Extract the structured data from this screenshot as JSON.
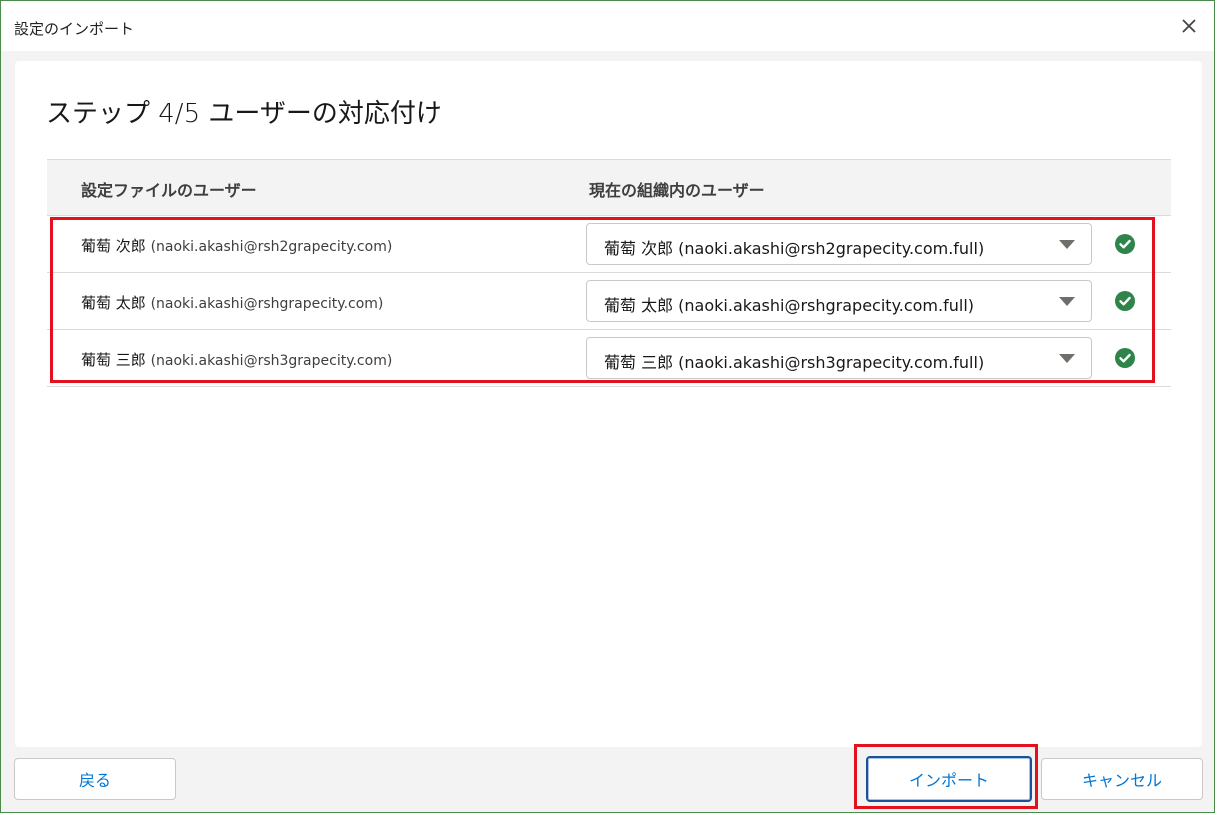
{
  "window": {
    "title": "設定のインポート"
  },
  "step": {
    "title": "ステップ 4/5 ユーザーの対応付け"
  },
  "table": {
    "headers": [
      "設定ファイルのユーザー",
      "現在の組織内のユーザー"
    ],
    "rows": [
      {
        "name": "葡萄 次郎",
        "email": "(naoki.akashi@rsh2grapecity.com)",
        "selected": "葡萄 次郎 (naoki.akashi@rsh2grapecity.com.full)",
        "status": "check-circle-icon"
      },
      {
        "name": "葡萄 太郎",
        "email": "(naoki.akashi@rshgrapecity.com)",
        "selected": "葡萄 太郎 (naoki.akashi@rshgrapecity.com.full)",
        "status": "check-circle-icon"
      },
      {
        "name": "葡萄 三郎",
        "email": "(naoki.akashi@rsh3grapecity.com)",
        "selected": "葡萄 三郎 (naoki.akashi@rsh3grapecity.com.full)",
        "status": "check-circle-icon"
      }
    ]
  },
  "footer": {
    "back_label": "戻る",
    "import_label": "インポート",
    "cancel_label": "キャンセル"
  },
  "colors": {
    "accent": "#0176d3",
    "success": "#2e844a",
    "highlight": "#e3111e",
    "focus": "#1b5297"
  }
}
